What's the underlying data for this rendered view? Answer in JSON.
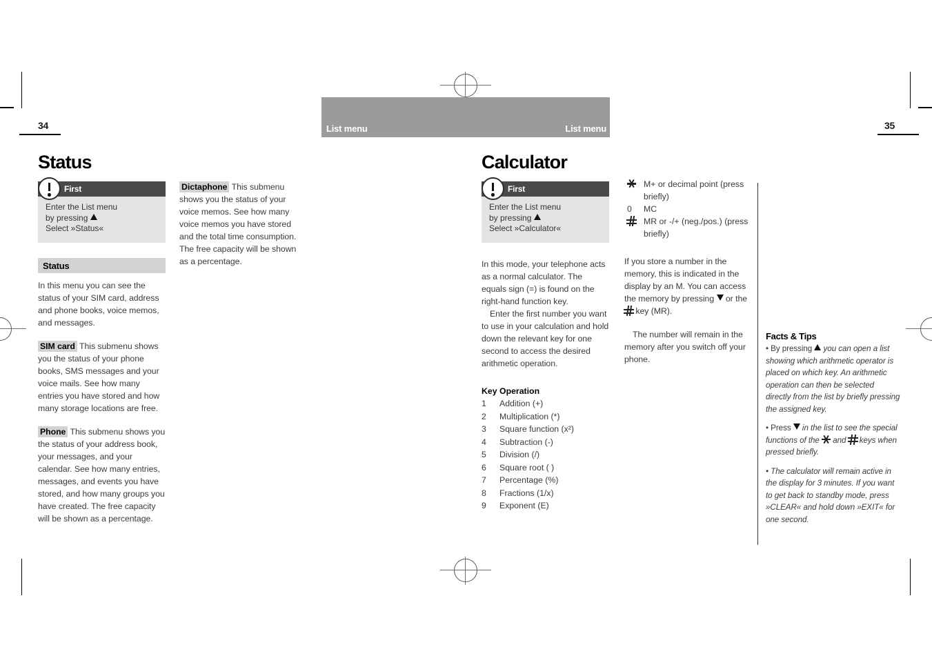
{
  "header": {
    "left_label": "List menu",
    "right_label": "List menu"
  },
  "pages": {
    "left_number": "34",
    "right_number": "35"
  },
  "left_page": {
    "title": "Status",
    "first_box": {
      "heading": "First",
      "line1": "Enter the List menu",
      "line2_prefix": "by pressing",
      "line3": "Select »Status«"
    },
    "subhead": "Status",
    "intro": "In this menu you can see the status of your SIM card, address and phone books, voice memos, and messages.",
    "sim_term": "SIM card",
    "sim_text": "This submenu shows you the status of your phone books, SMS messages and your voice mails. See how many entries you have stored and how many storage locations are free.",
    "phone_term": "Phone",
    "phone_text": "This submenu shows you the status of your address book, your messages, and your calendar. See how many entries, messages, and events you have stored, and how many groups you have created. The free capacity will be shown as a percentage.",
    "dictaphone_term": "Dictaphone",
    "dictaphone_text": "This submenu shows you the status of your voice memos. See how many voice memos you have stored and the total time consumption. The free capacity will be shown as a percentage."
  },
  "right_page": {
    "title": "Calculator",
    "first_box": {
      "heading": "First",
      "line1": "Enter the List menu",
      "line2_prefix": "by pressing",
      "line3": "Select »Calculator«"
    },
    "intro_p1": "In this mode, your telephone acts as a normal calculator. The equals sign (=) is found on the right-hand function key.",
    "intro_p2": "Enter the first number you want to use in your calculation and hold down the relevant key for one second to access the desired arithmetic operation.",
    "key_table": {
      "head_key": "Key",
      "head_operation": "Operation",
      "rows": [
        {
          "key": "1",
          "operation": "Addition (+)"
        },
        {
          "key": "2",
          "operation": "Multiplication (*)"
        },
        {
          "key": "3",
          "operation": "Square function (x²)"
        },
        {
          "key": "4",
          "operation": "Subtraction (-)"
        },
        {
          "key": "5",
          "operation": "Division (/)"
        },
        {
          "key": "6",
          "operation": "Square root (  )"
        },
        {
          "key": "7",
          "operation": "Percentage (%)"
        },
        {
          "key": "8",
          "operation": "Fractions (1/x)"
        },
        {
          "key": "9",
          "operation": "Exponent (E)"
        }
      ]
    },
    "symbol_rows": {
      "star_key": "star-glyph",
      "star_text": "M+ or decimal point (press briefly)",
      "zero_key": "0",
      "zero_text": "MC",
      "hash_key": "hash-glyph",
      "hash_text": "MR or -/+ (neg./pos.) (press briefly)"
    },
    "memory_p1_a": "If you store a number in the memory, this is indicated in the display by an M. You can access the memory by pressing",
    "memory_p1_b": "or the",
    "memory_p1_c": "key (MR).",
    "memory_p2": "The number will remain in the memory after you switch off your phone."
  },
  "facts": {
    "title": "Facts & Tips",
    "item1_a": "• By pressing",
    "item1_b": "you can open a list showing which arithmetic operator is placed on which key. An arithmetic operation can then be selected directly from the list by briefly pressing the assigned key.",
    "item2_a": "• Press",
    "item2_b": "in the list to see the special functions of the",
    "item2_c": "and",
    "item2_d": "keys when pressed briefly.",
    "item3": "• The calculator will remain active in the display for 3 minutes. If you want to get back to standby mode, press »CLEAR« and hold down »EXIT« for one second."
  },
  "colors": {
    "header_band": "#9b9b9b",
    "callout_head": "#4a4a4a",
    "callout_body": "#e3e3e3",
    "subhead_band": "#d2d2d2"
  }
}
